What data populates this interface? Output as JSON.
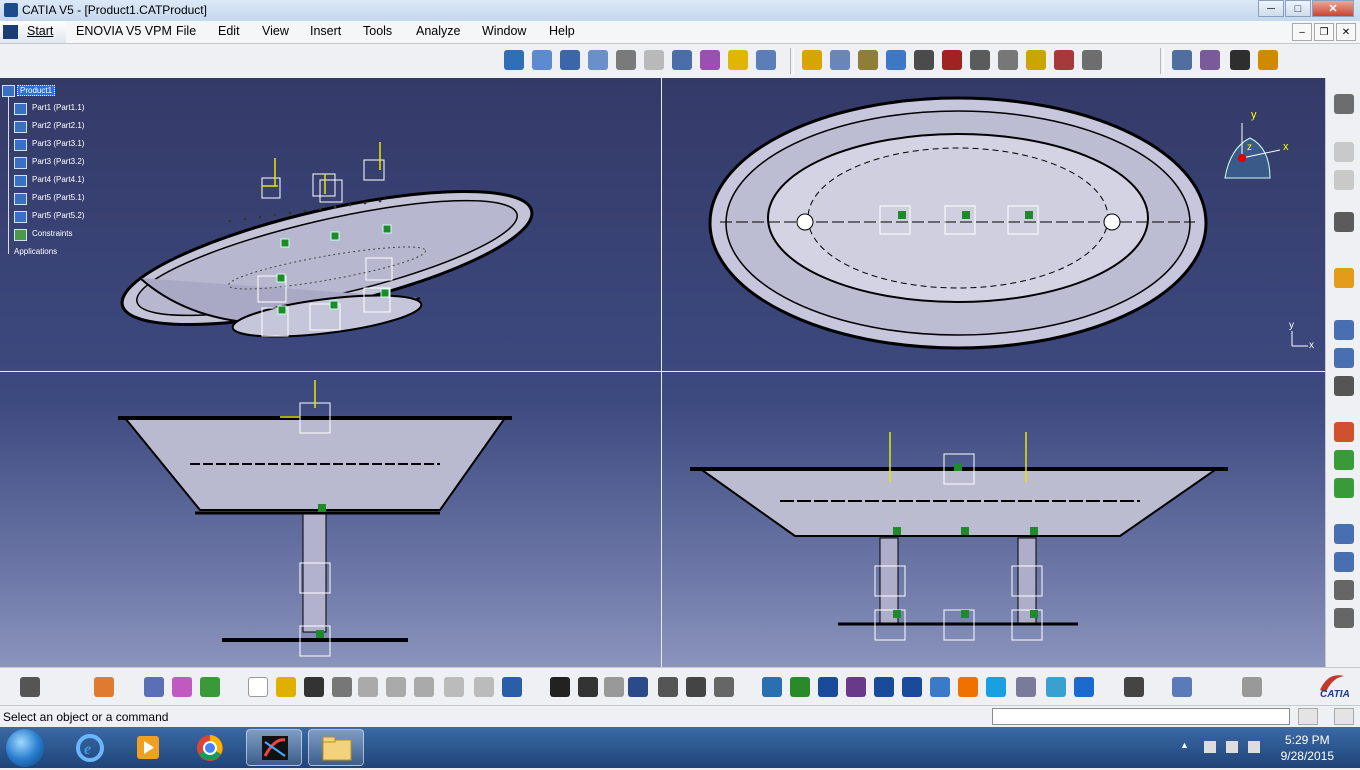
{
  "window": {
    "title": "CATIA V5 - [Product1.CATProduct]",
    "minimize": "─",
    "maximize": "□",
    "close": "✕"
  },
  "menu": {
    "start": "Start",
    "items": [
      "ENOVIA V5 VPM",
      "File",
      "Edit",
      "View",
      "Insert",
      "Tools",
      "Analyze",
      "Window",
      "Help"
    ]
  },
  "tree": {
    "root": "Product1",
    "items": [
      "Part1 (Part1.1)",
      "Part2 (Part2.1)",
      "Part3 (Part3.1)",
      "Part3 (Part3.2)",
      "Part4 (Part4.1)",
      "Part5 (Part5.1)",
      "Part5 (Part5.2)",
      "Constraints",
      "Applications"
    ]
  },
  "compass": {
    "x_label": "x",
    "y_label": "y",
    "z_label": "z"
  },
  "axis_small": {
    "x": "x",
    "y": "y"
  },
  "status": {
    "message": "Select an object or a command",
    "command_value": ""
  },
  "brand": {
    "logo_text": "CATIA"
  },
  "taskbar": {
    "time": "5:29 PM",
    "date": "9/28/2015"
  },
  "colors": {
    "viewport_top": "#343a68",
    "viewport_bottom": "#8a94bd",
    "constraint_green": "#1e8a2a",
    "axis_yellow": "#e6e600"
  }
}
